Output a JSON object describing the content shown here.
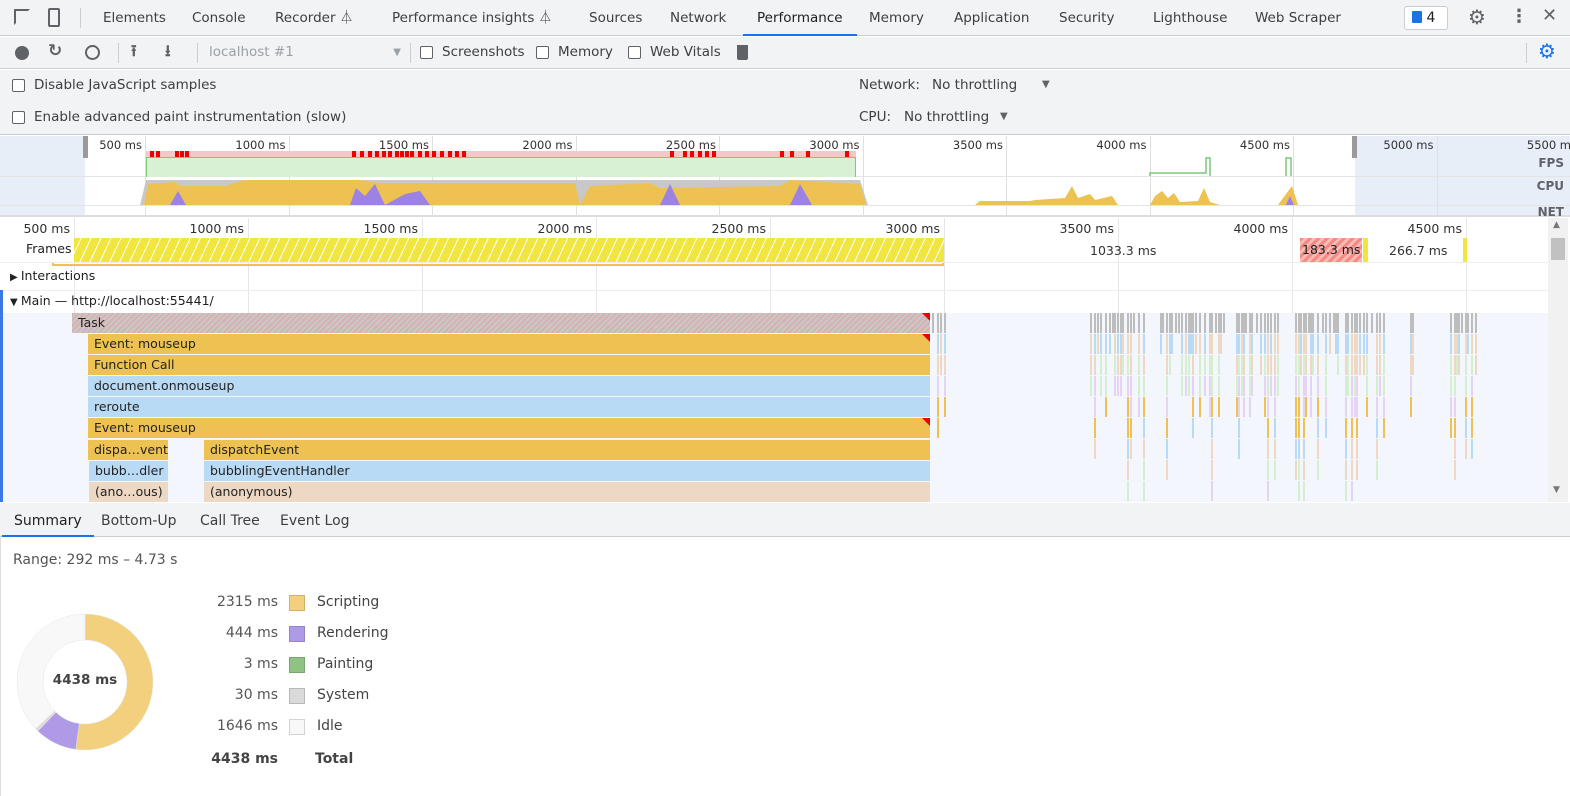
{
  "tabs": [
    {
      "label": "Elements"
    },
    {
      "label": "Console"
    },
    {
      "label": "Recorder ⏃"
    },
    {
      "label": "Performance insights ⏃"
    },
    {
      "label": "Sources"
    },
    {
      "label": "Network"
    },
    {
      "label": "Performance",
      "active": true
    },
    {
      "label": "Memory"
    },
    {
      "label": "Application"
    },
    {
      "label": "Security"
    },
    {
      "label": "Lighthouse"
    },
    {
      "label": "Web Scraper"
    }
  ],
  "issues_badge": "4",
  "toolbar": {
    "target": "localhost #1",
    "screenshots": "Screenshots",
    "memory": "Memory",
    "web_vitals": "Web Vitals"
  },
  "settings": {
    "disable_js": "Disable JavaScript samples",
    "adv_paint": "Enable advanced paint instrumentation (slow)",
    "network_label": "Network:",
    "network_value": "No throttling",
    "cpu_label": "CPU:",
    "cpu_value": "No throttling"
  },
  "overview": {
    "ticks": [
      "500 ms",
      "1000 ms",
      "1500 ms",
      "2000 ms",
      "2500 ms",
      "3000 ms",
      "3500 ms",
      "4000 ms",
      "4500 ms",
      "5000 ms",
      "5500 ms"
    ],
    "lanes": [
      "FPS",
      "CPU",
      "NET"
    ]
  },
  "timeline": {
    "ticks": [
      "500 ms",
      "1000 ms",
      "1500 ms",
      "2000 ms",
      "2500 ms",
      "3000 ms",
      "3500 ms",
      "4000 ms",
      "4500 ms"
    ],
    "frames_label": "Frames",
    "frame_durations": [
      "1033.3 ms",
      "183.3 ms",
      "266.7 ms"
    ],
    "interactions": "Interactions",
    "main_title": "Main — http://localhost:55441/",
    "flame": [
      "Task",
      "Event: mouseup",
      "Function Call",
      "document.onmouseup",
      "reroute",
      "Event: mouseup",
      "dispa…vent",
      "dispatchEvent",
      "bubb…dler",
      "bubblingEventHandler",
      "(ano…ous)",
      "(anonymous)"
    ]
  },
  "bottom_tabs": [
    "Summary",
    "Bottom-Up",
    "Call Tree",
    "Event Log"
  ],
  "summary": {
    "range": "Range: 292 ms – 4.73 s",
    "total_center": "4438 ms",
    "items": [
      {
        "value": "2315 ms",
        "name": "Scripting",
        "ms": 2315,
        "color": "#f2d07e"
      },
      {
        "value": "444 ms",
        "name": "Rendering",
        "ms": 444,
        "color": "#af9ae8"
      },
      {
        "value": "3 ms",
        "name": "Painting",
        "ms": 3,
        "color": "#8fc383"
      },
      {
        "value": "30 ms",
        "name": "System",
        "ms": 30,
        "color": "#dadada"
      },
      {
        "value": "1646 ms",
        "name": "Idle",
        "ms": 1646,
        "color": "#f8f8f8"
      }
    ],
    "total_value": "4438 ms",
    "total_label": "Total"
  }
}
